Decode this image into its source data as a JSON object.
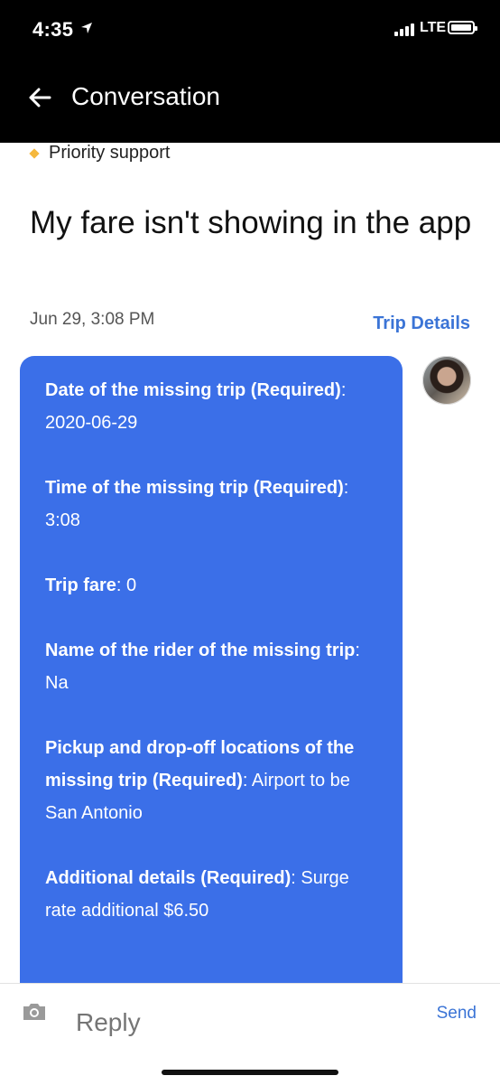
{
  "status_bar": {
    "time": "4:35",
    "network": "LTE"
  },
  "header": {
    "title": "Conversation"
  },
  "conversation": {
    "priority_label": "Priority support",
    "subject": "My fare isn't showing in the app",
    "date": "Jun 29, 3:08 PM",
    "trip_details_label": "Trip Details",
    "message": {
      "fields": [
        {
          "key": "Date of the missing trip (Required)",
          "value": "2020-06-29"
        },
        {
          "key": "Time of the missing trip (Required)",
          "value": "3:08"
        },
        {
          "key": "Trip fare",
          "value": "0"
        },
        {
          "key": "Name of the rider of the missing trip",
          "value": "Na"
        },
        {
          "key": "Pickup and drop-off locations of the missing trip (Required)",
          "value": "Airport to be San Antonio"
        },
        {
          "key": "Additional details (Required)",
          "value": "Surge rate additional $6.50"
        }
      ]
    }
  },
  "reply": {
    "placeholder": "Reply",
    "send_label": "Send"
  },
  "colors": {
    "accent": "#3b74d6",
    "bubble": "#3b6fe8",
    "priority_diamond": "#f5b83d"
  }
}
